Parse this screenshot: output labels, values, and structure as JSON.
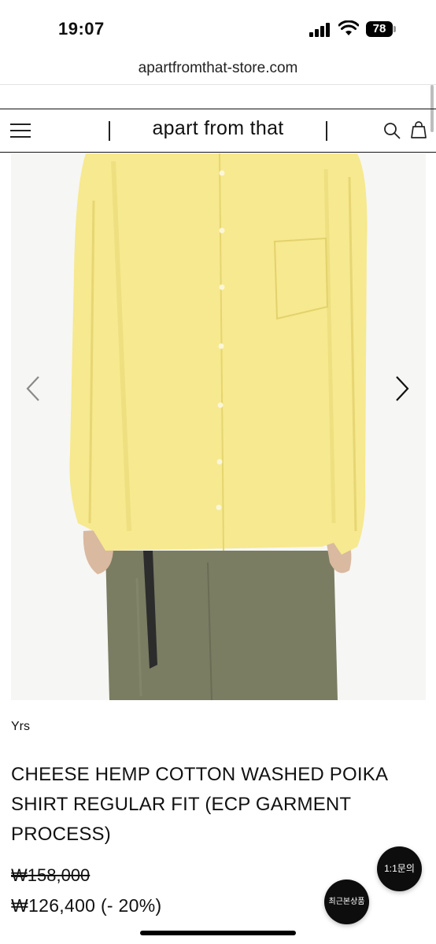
{
  "status_bar": {
    "time": "19:07",
    "battery": "78"
  },
  "browser": {
    "url": "apartfromthat-store.com"
  },
  "header": {
    "brand": "apart from that",
    "icons": [
      "menu-icon",
      "search-icon",
      "cart-icon"
    ]
  },
  "product": {
    "brand": "Yrs",
    "title": "CHEESE HEMP COTTON WASHED POIKA SHIRT REGULAR FIT (ECP GARMENT PROCESS)",
    "original_price": "₩158,000",
    "sale_price": "₩126,400 (- 20%)",
    "image_colors": {
      "shirt": "#f6e98f",
      "pants": "#7a7d62",
      "background": "#f5f5f3"
    }
  },
  "floating": {
    "inquiry": "1:1문의",
    "recent": "최근본상품"
  }
}
